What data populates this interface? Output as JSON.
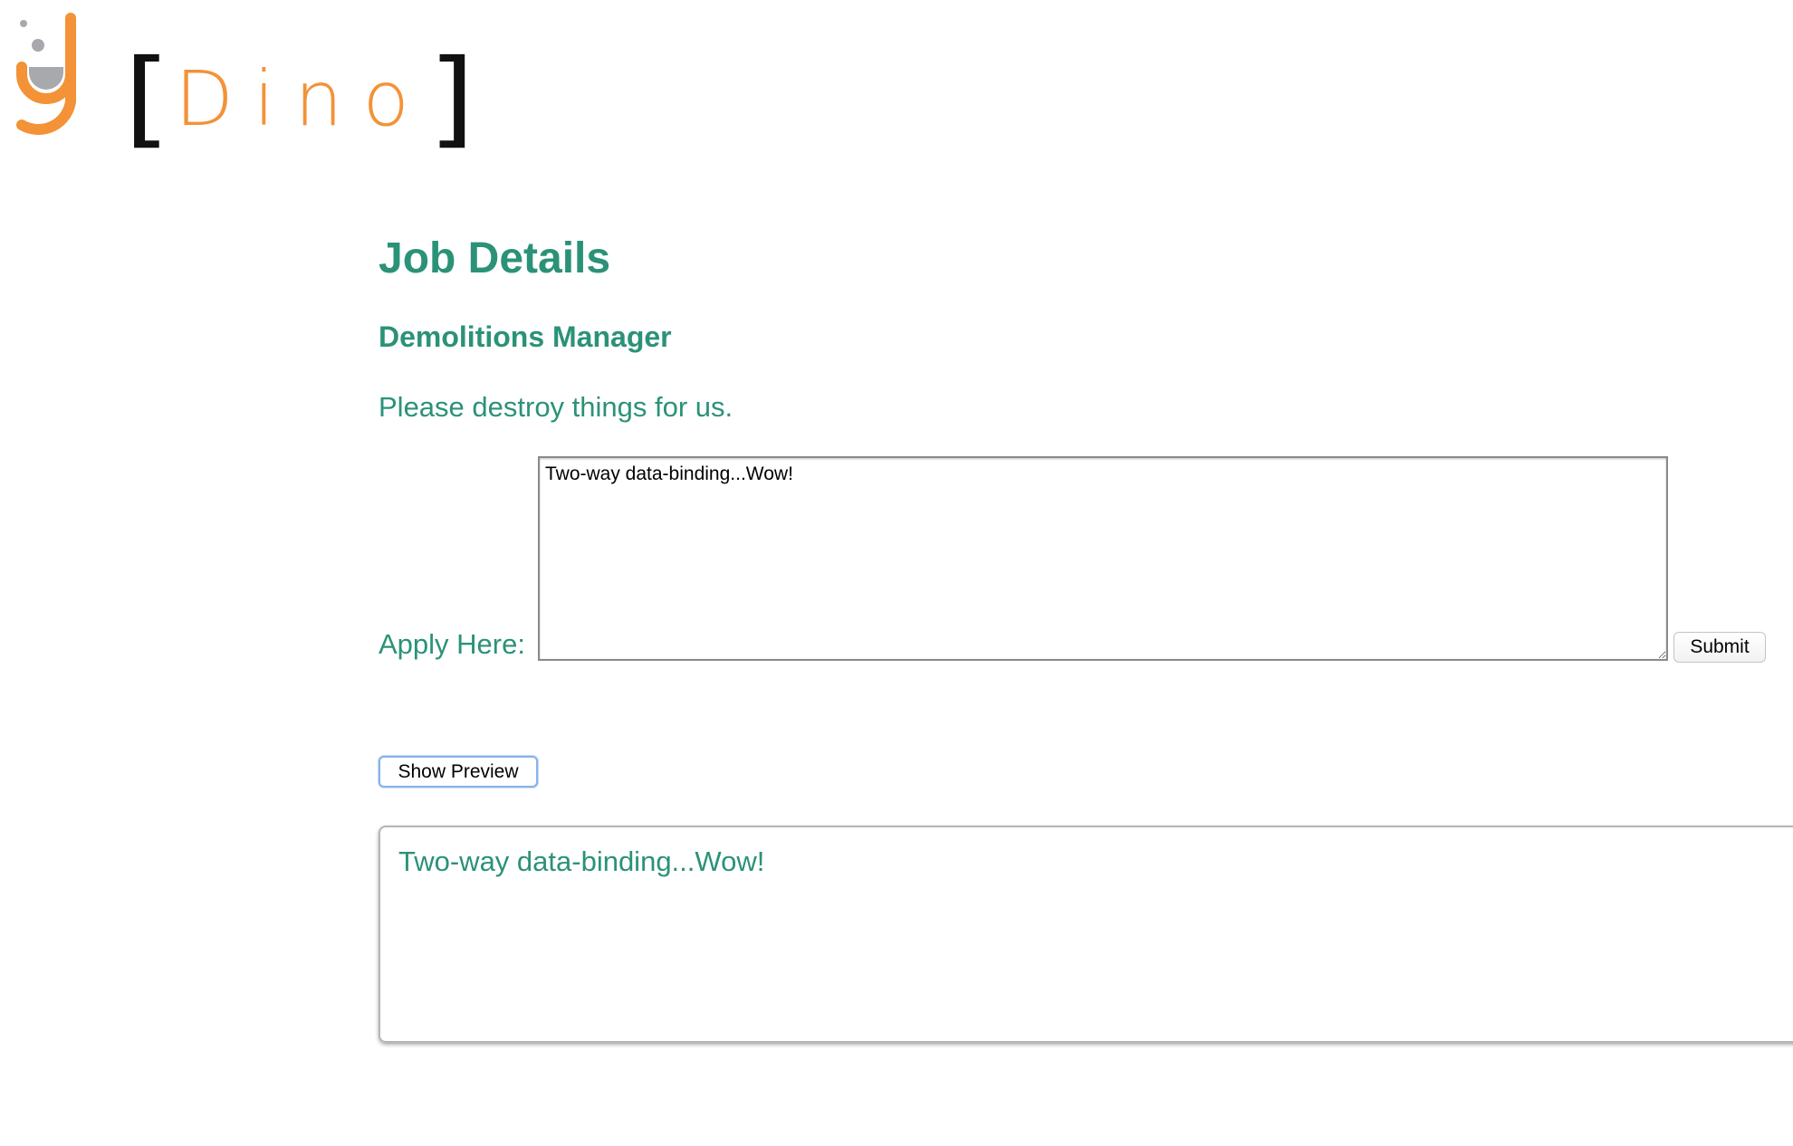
{
  "logo": {
    "text": "Dino",
    "bracket_open": "[",
    "bracket_close": "]",
    "colors": {
      "orange": "#f39237",
      "gray": "#a7a9ac",
      "bracket": "#111111"
    }
  },
  "header": {
    "title": "Job Details"
  },
  "job": {
    "title": "Demolitions Manager",
    "description": "Please destroy things for us."
  },
  "apply": {
    "label": "Apply Here:",
    "value": "Two-way data-binding...Wow!",
    "submit_label": "Submit"
  },
  "preview": {
    "button_label": "Show Preview",
    "text": "Two-way data-binding...Wow!"
  },
  "colors": {
    "accent": "#2b9278",
    "focus_ring": "#89b3e8"
  }
}
